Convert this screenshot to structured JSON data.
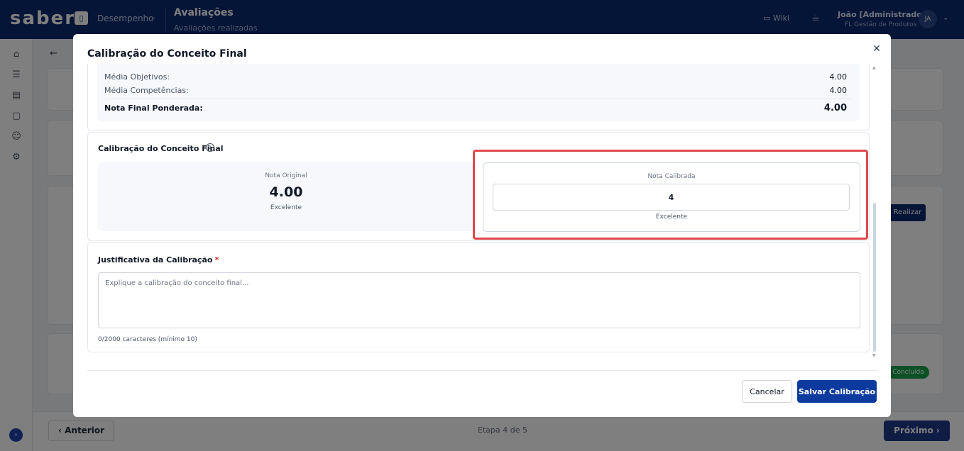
{
  "topbar": {
    "logo": "saber",
    "module": "Desempenho",
    "page_title": "Avaliações",
    "page_subtitle": "Avaliações realizadas",
    "wiki": "Wiki",
    "user_name": "João [Administrador]",
    "user_org": "FL Gestão de Produtos",
    "user_initials": "JA"
  },
  "background": {
    "realizar": "Realizar",
    "concluida": "Concluída",
    "anterior": "Anterior",
    "step": "Etapa 4 de 5",
    "proximo": "Próximo"
  },
  "modal": {
    "title": "Calibração do Conceito Final",
    "summary": {
      "media_objetivos_label": "Média Objetivos:",
      "media_objetivos_value": "4.00",
      "media_competencias_label": "Média Competências:",
      "media_competencias_value": "4.00",
      "nota_final_label": "Nota Final Ponderada:",
      "nota_final_value": "4.00"
    },
    "calibration": {
      "title": "Calibração do Conceito Final",
      "original_label": "Nota Original",
      "original_value": "4.00",
      "original_concept": "Excelente",
      "calibrated_label": "Nota Calibrada",
      "calibrated_value": "4",
      "calibrated_concept": "Excelente"
    },
    "justification": {
      "title": "Justificativa da Calibração",
      "required_mark": "*",
      "placeholder": "Explique a calibração do conceito final...",
      "counter": "0/2000 caracteres (mínimo 10)"
    },
    "cancel_label": "Cancelar",
    "save_label": "Salvar Calibração"
  },
  "colors": {
    "brand": "#0b2a6f",
    "primary_button": "#0d3a9e",
    "highlight": "#e0484a"
  }
}
